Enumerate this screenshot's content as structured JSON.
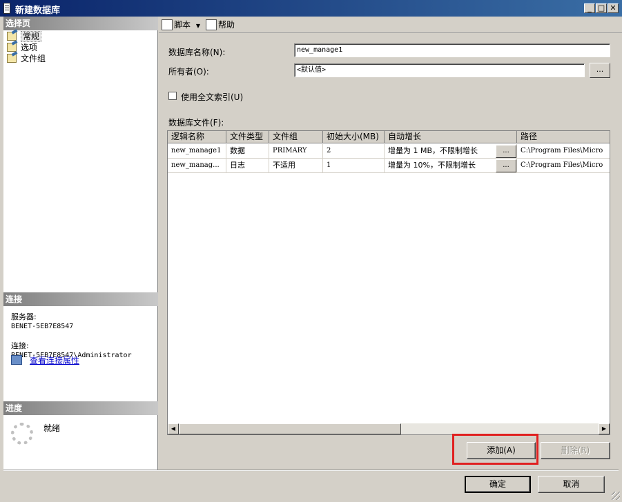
{
  "window": {
    "title": "新建数据库",
    "minimize": "_",
    "maximize": "□",
    "close": "✕"
  },
  "left_pane": {
    "select_page_header": "选择页",
    "pages": [
      {
        "label": "常规",
        "icon": "page-icon",
        "selected": true
      },
      {
        "label": "选项",
        "icon": "page-icon",
        "selected": false
      },
      {
        "label": "文件组",
        "icon": "page-icon",
        "selected": false
      }
    ],
    "connection_header": "连接",
    "server_label": "服务器:",
    "server_value": "BENET-5EB7E8547",
    "connection_label": "连接:",
    "connection_value": "BENET-5EB7E8547\\Administrator",
    "view_properties_link": "查看连接属性",
    "progress_header": "进度",
    "progress_status": "就绪"
  },
  "toolbar": {
    "script_label": "脚本",
    "help_label": "帮助"
  },
  "form": {
    "db_name_label": "数据库名称(N):",
    "db_name_value": "new_manage1",
    "owner_label": "所有者(O):",
    "owner_value": "<默认值>",
    "browse_button": "...",
    "fulltext_label": "使用全文索引(U)",
    "db_files_label": "数据库文件(F):"
  },
  "grid": {
    "columns": [
      "逻辑名称",
      "文件类型",
      "文件组",
      "初始大小(MB)",
      "自动增长",
      "路径"
    ],
    "rows": [
      [
        "new_manage1",
        "数据",
        "PRIMARY",
        "2",
        "增量为 1 MB，不限制增长",
        "C:\\Program Files\\Micro"
      ],
      [
        "new_manag...",
        "日志",
        "不适用",
        "1",
        "增量为 10%，不限制增长",
        "C:\\Program Files\\Micro"
      ]
    ],
    "cell_button": "...",
    "scroll_left": "◀",
    "scroll_right": "▶"
  },
  "buttons": {
    "add": "添加(A)",
    "remove": "删除(R)",
    "ok": "确定",
    "cancel": "取消"
  },
  "colors": {
    "highlight_box": "#e02020",
    "title_bar": "#0a246a",
    "link": "#0000cc"
  }
}
